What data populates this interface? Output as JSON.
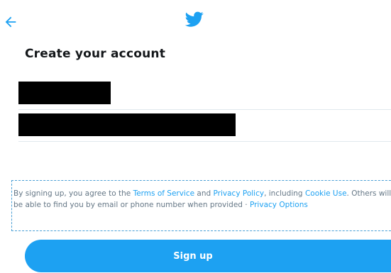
{
  "header": {
    "back_icon": "arrow-left-icon",
    "logo_icon": "twitter-bird-icon"
  },
  "title": "Create your account",
  "form": {
    "name_value": "",
    "contact_value": ""
  },
  "legal": {
    "part1": "By signing up, you agree to the ",
    "terms": "Terms of Service",
    "part2": " and ",
    "privacy": "Privacy Policy",
    "part3": ", including ",
    "cookie": "Cookie Use",
    "part4": ". Others will be able to find you by email or phone number when provided · ",
    "privacy_options": "Privacy Options"
  },
  "signup_label": "Sign up",
  "colors": {
    "accent": "#1da1f2",
    "text": "#14171a",
    "muted": "#657786"
  }
}
